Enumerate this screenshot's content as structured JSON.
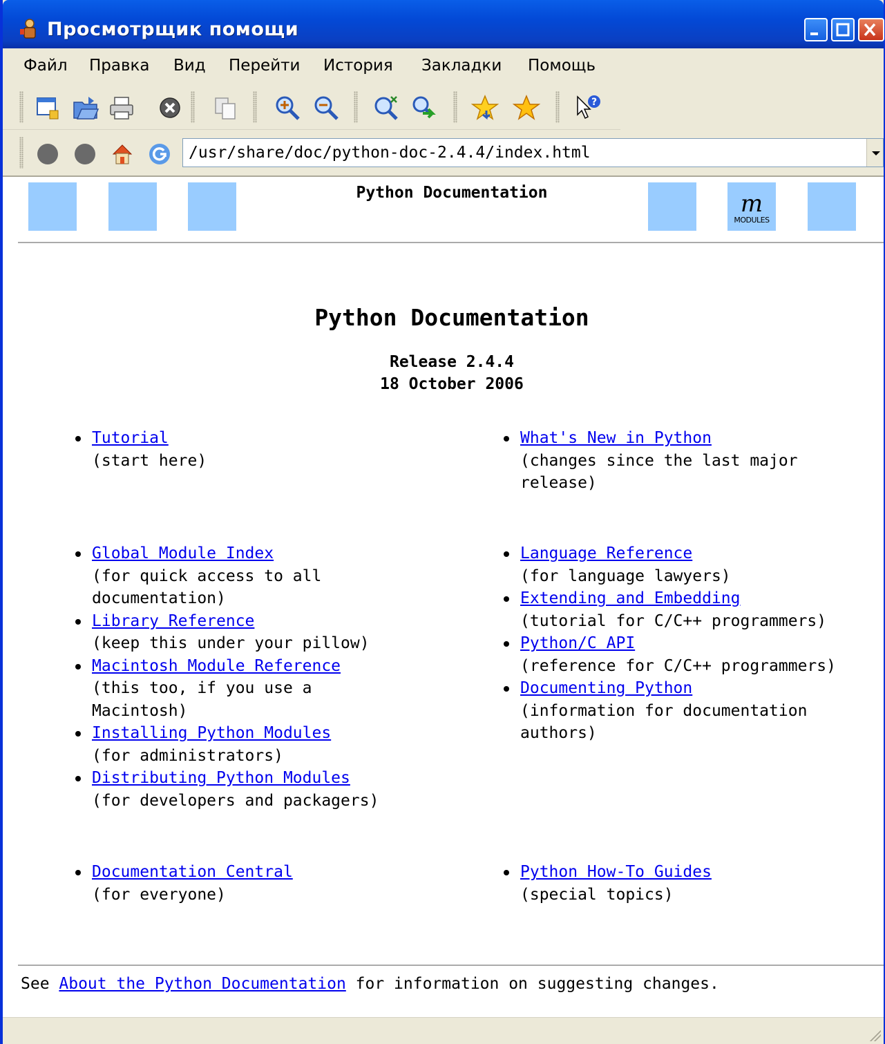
{
  "window": {
    "title": "Просмотрщик помощи",
    "colors": {
      "titlebar": "#0349d6",
      "link": "#0000ee",
      "nav_box": "#99ccff"
    }
  },
  "menu": {
    "items": [
      "Файл",
      "Правка",
      "Вид",
      "Перейти",
      "История",
      "Закладки",
      "Помощь"
    ]
  },
  "toolbar": {
    "icons": [
      "new-window-icon",
      "open-icon",
      "print-icon",
      "stop-icon",
      "copy-icon",
      "zoom-in-icon",
      "zoom-out-icon",
      "find-icon",
      "find-next-icon",
      "add-bookmark-icon",
      "bookmarks-icon",
      "context-help-icon"
    ]
  },
  "location": {
    "url": "/usr/share/doc/python-doc-2.4.4/index.html"
  },
  "page": {
    "header_title": "Python Documentation",
    "modules_glyph": "m",
    "modules_label": "MODULES",
    "title": "Python Documentation",
    "release": "Release 2.4.4",
    "date": "18 October 2006",
    "groups": [
      {
        "left": [
          {
            "link": "Tutorial",
            "desc": "(start here)"
          }
        ],
        "right": [
          {
            "link": "What's New in Python",
            "desc": "(changes since the last major release)"
          }
        ]
      },
      {
        "left": [
          {
            "link": "Global Module Index",
            "desc": "(for quick access to all documentation)"
          },
          {
            "link": "Library Reference",
            "desc": "(keep this under your pillow)"
          },
          {
            "link": "Macintosh Module Reference",
            "desc": "(this too, if you use a Macintosh)"
          },
          {
            "link": "Installing Python Modules",
            "desc": "(for administrators)"
          },
          {
            "link": "Distributing Python Modules",
            "desc": "(for developers and packagers)"
          }
        ],
        "right": [
          {
            "link": "Language Reference",
            "desc": "(for language lawyers)"
          },
          {
            "link": "Extending and Embedding",
            "desc": "(tutorial for C/C++ programmers)"
          },
          {
            "link": "Python/C API",
            "desc": "(reference for C/C++ programmers)"
          },
          {
            "link": "Documenting Python",
            "desc": "(information for documentation authors)"
          }
        ]
      },
      {
        "left": [
          {
            "link": "Documentation Central",
            "desc": "(for everyone)"
          }
        ],
        "right": [
          {
            "link": "Python How-To Guides",
            "desc": "(special topics)"
          }
        ]
      }
    ],
    "footer_prefix": "See ",
    "footer_link": "About the Python Documentation",
    "footer_suffix": " for information on suggesting changes."
  }
}
